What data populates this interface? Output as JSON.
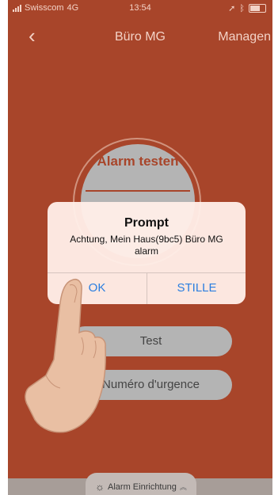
{
  "status_bar": {
    "carrier": "Swisscom",
    "network": "4G",
    "time": "13:54"
  },
  "nav": {
    "back_icon": "chevron-left-icon",
    "title": "Büro MG",
    "manage_label": "Managen"
  },
  "alarm": {
    "test_label": "Alarm testen"
  },
  "actions": {
    "test_label": "Test",
    "urgence_label": "Numéro d'urgence"
  },
  "dialog": {
    "title": "Prompt",
    "message": "Achtung, Mein Haus(9bc5) Büro MG alarm",
    "ok_label": "OK",
    "stille_label": "STILLE"
  },
  "bottom_tab": {
    "icon": "lightbulb-icon",
    "label": "Alarm Einrichtung",
    "chevron_icon": "chevron-up-icon"
  },
  "colors": {
    "background": "#a8452a",
    "accent_blue": "#2a7ee0",
    "pill_gray": "#b4b4b4"
  }
}
